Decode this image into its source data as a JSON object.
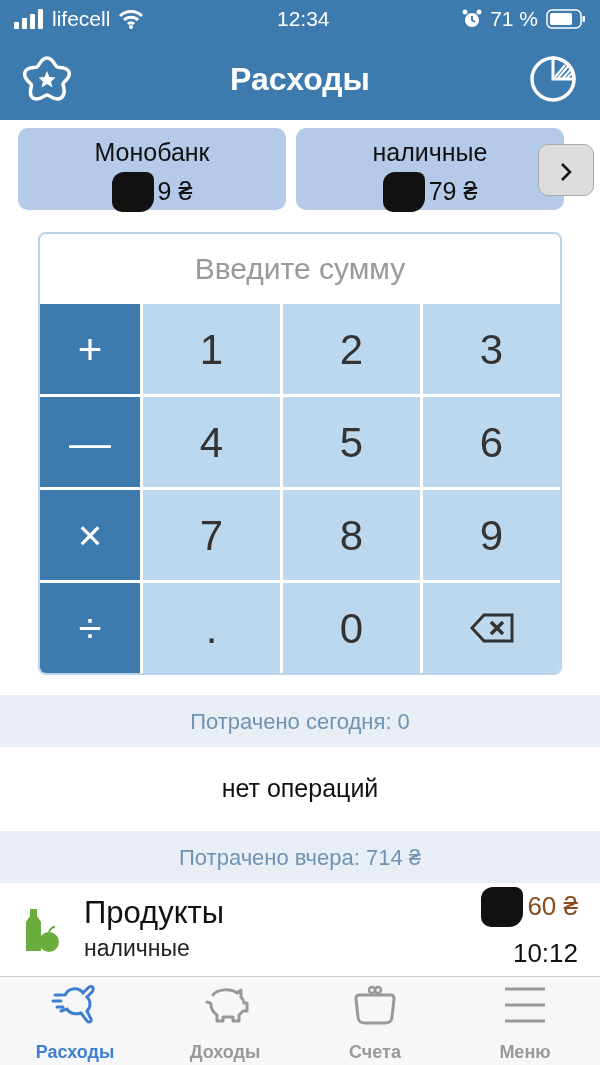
{
  "status_bar": {
    "carrier": "lifecell",
    "time": "12:34",
    "battery": "71 %"
  },
  "header": {
    "title": "Расходы"
  },
  "accounts": [
    {
      "name": "Монобанк",
      "amount": "9 ₴"
    },
    {
      "name": "наличные",
      "amount": "79 ₴"
    }
  ],
  "amount_field": {
    "placeholder": "Введите сумму"
  },
  "keypad": [
    [
      {
        "kind": "op",
        "label": "+"
      },
      {
        "kind": "digit",
        "label": "1"
      },
      {
        "kind": "digit",
        "label": "2"
      },
      {
        "kind": "digit",
        "label": "3"
      }
    ],
    [
      {
        "kind": "op",
        "label": "—"
      },
      {
        "kind": "digit",
        "label": "4"
      },
      {
        "kind": "digit",
        "label": "5"
      },
      {
        "kind": "digit",
        "label": "6"
      }
    ],
    [
      {
        "kind": "op",
        "label": "×"
      },
      {
        "kind": "digit",
        "label": "7"
      },
      {
        "kind": "digit",
        "label": "8"
      },
      {
        "kind": "digit",
        "label": "9"
      }
    ],
    [
      {
        "kind": "op",
        "label": "÷"
      },
      {
        "kind": "digit",
        "label": "."
      },
      {
        "kind": "digit",
        "label": "0"
      },
      {
        "kind": "backspace"
      }
    ]
  ],
  "sections": [
    {
      "heading": "Потрачено сегодня: 0",
      "empty_text": "нет операций"
    },
    {
      "heading": "Потрачено вчера: 714 ₴",
      "operations": [
        {
          "category": "Продукты",
          "account": "наличные",
          "amount": "60 ₴",
          "time": "10:12"
        }
      ]
    }
  ],
  "tab_bar": [
    {
      "label": "Расходы",
      "selected": true
    },
    {
      "label": "Доходы",
      "selected": false
    },
    {
      "label": "Счета",
      "selected": false
    },
    {
      "label": "Меню",
      "selected": false
    }
  ]
}
